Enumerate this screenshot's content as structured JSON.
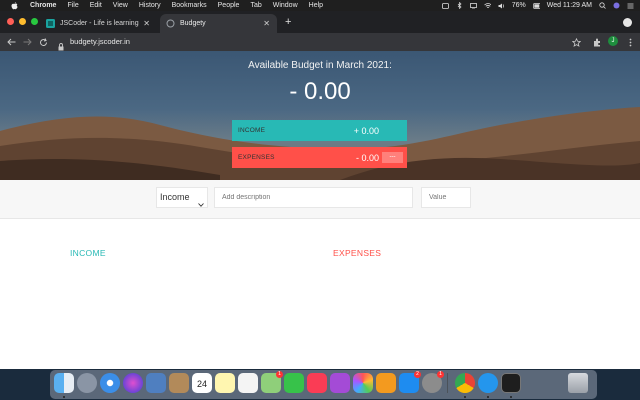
{
  "menubar": {
    "app_name": "Chrome",
    "items": [
      "File",
      "Edit",
      "View",
      "History",
      "Bookmarks",
      "People",
      "Tab",
      "Window",
      "Help"
    ],
    "battery": "76%",
    "clock": "Wed 11:29 AM",
    "icons": [
      "apple-icon",
      "tray-icon",
      "bluetooth-icon",
      "screen-icon",
      "wifi-icon",
      "volume-icon",
      "battery-icon",
      "search-icon",
      "siri-icon",
      "menu-icon"
    ]
  },
  "browser": {
    "tabs": [
      {
        "title": "JSCoder - Life is learning",
        "active": false
      },
      {
        "title": "Budgety",
        "active": true
      }
    ],
    "new_tab_label": "+",
    "url": "budgety.jscoder.in",
    "profile_initial": "J"
  },
  "app": {
    "budget_title": "Available Budget in March 2021:",
    "budget_value": "- 0.00",
    "income_label": "INCOME",
    "income_value": "+ 0.00",
    "expenses_label": "EXPENSES",
    "expenses_value": "- 0.00",
    "expenses_percentage": "---",
    "type_selected": "Income",
    "description_placeholder": "Add description",
    "value_placeholder": "Value",
    "income_list_title": "INCOME",
    "expenses_list_title": "EXPENSES",
    "colors": {
      "income": "#28b9b5",
      "expense": "#ff5049"
    }
  },
  "dock": {
    "icons": [
      "finder-icon",
      "launchpad-icon",
      "safari-icon",
      "siri-icon",
      "photos-viewer-icon",
      "contacts-icon",
      "calendar-icon",
      "notes-icon",
      "reminders-icon",
      "maps-icon",
      "facetime-icon",
      "music-icon",
      "podcasts-icon",
      "photos-icon",
      "books-icon",
      "app-store-icon",
      "system-preferences-icon",
      "chrome-icon",
      "docker-icon",
      "terminal-icon",
      "trash-icon"
    ],
    "calendar_day": "24",
    "badges": [
      "1",
      "2",
      "1"
    ]
  }
}
